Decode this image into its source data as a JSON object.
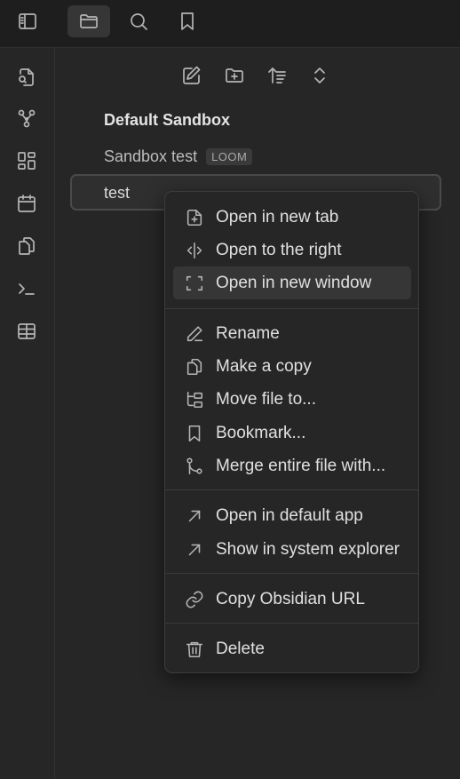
{
  "topbar": {
    "buttons": [
      {
        "icon": "sidebar-toggle-icon",
        "active": false
      },
      {
        "icon": "folder-icon",
        "active": true
      },
      {
        "icon": "search-icon",
        "active": false
      },
      {
        "icon": "bookmark-icon",
        "active": false
      }
    ]
  },
  "ribbon": {
    "icons": [
      "file-search-icon",
      "graph-icon",
      "dashboard-icon",
      "calendar-icon",
      "copy-files-icon",
      "terminal-icon",
      "table-icon"
    ]
  },
  "explorer": {
    "nav_icons": [
      "new-note-icon",
      "new-folder-icon",
      "sort-icon",
      "collapse-icon"
    ],
    "vault_name": "Default Sandbox",
    "files": [
      {
        "name": "Sandbox test",
        "tag": "LOOM"
      },
      {
        "name": "test",
        "selected": true
      }
    ]
  },
  "context_menu": {
    "items": [
      {
        "label": "Open in new tab",
        "icon": "file-plus-icon"
      },
      {
        "label": "Open to the right",
        "icon": "split-view-icon"
      },
      {
        "label": "Open in new window",
        "icon": "maximize-icon",
        "hover": true
      },
      {
        "label": "Rename",
        "icon": "pencil-icon"
      },
      {
        "label": "Make a copy",
        "icon": "copy-icon"
      },
      {
        "label": "Move file to...",
        "icon": "folder-tree-icon"
      },
      {
        "label": "Bookmark...",
        "icon": "bookmark-icon"
      },
      {
        "label": "Merge entire file with...",
        "icon": "git-merge-icon"
      },
      {
        "label": "Open in default app",
        "icon": "arrow-up-right-icon"
      },
      {
        "label": "Show in system explorer",
        "icon": "arrow-up-right-icon"
      },
      {
        "label": "Copy Obsidian URL",
        "icon": "link-icon"
      },
      {
        "label": "Delete",
        "icon": "trash-icon"
      }
    ]
  },
  "colors": {
    "background": "#262626",
    "topbar": "#1e1e1e",
    "menu_hover": "#363636",
    "text": "#dadada"
  }
}
